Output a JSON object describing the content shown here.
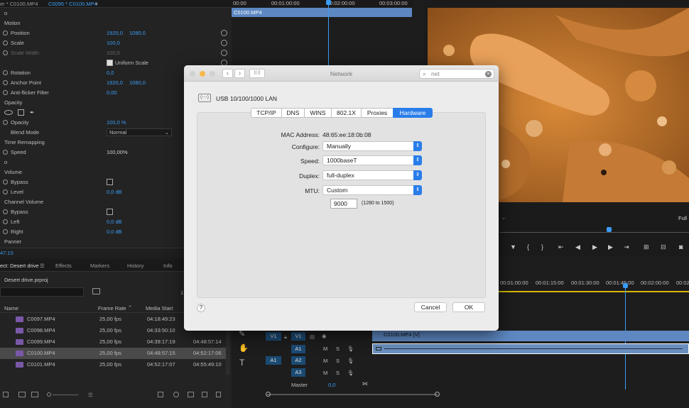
{
  "effect_controls": {
    "tab_left": "er * C0100.MP4",
    "tab_active": "C0095 * C0100.MP4",
    "clip_name": "C0100.MP4",
    "rows": [
      {
        "label": "o",
        "kind": "section"
      },
      {
        "label": "Motion",
        "kind": "section"
      },
      {
        "label": "Position",
        "v1": "1920,0",
        "v2": "1080,0",
        "kind": "prop"
      },
      {
        "label": "Scale",
        "v1": "100,0",
        "kind": "prop"
      },
      {
        "label": "Scale Width",
        "v1": "100,0",
        "kind": "disabled"
      },
      {
        "label": "Uniform Scale",
        "kind": "check"
      },
      {
        "label": "Rotation",
        "v1": "0,0",
        "kind": "prop"
      },
      {
        "label": "Anchor Point",
        "v1": "1920,0",
        "v2": "1080,0",
        "kind": "prop"
      },
      {
        "label": "Anti-flicker Filter",
        "v1": "0,00",
        "kind": "prop"
      },
      {
        "label": "Opacity",
        "kind": "section"
      },
      {
        "label": "",
        "kind": "shapes"
      },
      {
        "label": "Opacity",
        "v1": "100,0 %",
        "kind": "prop"
      },
      {
        "label": "Blend Mode",
        "v1": "Normal",
        "kind": "dropdown"
      },
      {
        "label": "Time Remapping",
        "kind": "section"
      },
      {
        "label": "Speed",
        "v1": "100,00%",
        "kind": "propw"
      },
      {
        "label": "o",
        "kind": "section"
      },
      {
        "label": "Volume",
        "kind": "section"
      },
      {
        "label": "Bypass",
        "kind": "checkv"
      },
      {
        "label": "Level",
        "v1": "0,0 dB",
        "kind": "prop"
      },
      {
        "label": "Channel Volume",
        "kind": "section"
      },
      {
        "label": "Bypass",
        "kind": "checkv"
      },
      {
        "label": "Left",
        "v1": "0,0 dB",
        "kind": "prop"
      },
      {
        "label": "Right",
        "v1": "0,0 dB",
        "kind": "prop"
      },
      {
        "label": "Panner",
        "kind": "section"
      }
    ],
    "timecode": "47:15"
  },
  "project": {
    "tabs": [
      "ect: Desert drive",
      "Effects",
      "Markers",
      "History",
      "Info"
    ],
    "file": "Desert drive.prproj",
    "count": "1",
    "columns": [
      "Name",
      "Frame Rate",
      "Media Start"
    ],
    "rows": [
      {
        "name": "C0097.MP4",
        "rate": "25,00 fps",
        "start": "04:18:49:23",
        "end": ""
      },
      {
        "name": "C0098.MP4",
        "rate": "25,00 fps",
        "start": "04:33:50:10",
        "end": ""
      },
      {
        "name": "C0099.MP4",
        "rate": "25,00 fps",
        "start": "04:39:17:19",
        "end": "04:48:57:14"
      },
      {
        "name": "C0100.MP4",
        "rate": "25,00 fps",
        "start": "04:48:57:15",
        "end": "04:52:17:06",
        "selected": true
      },
      {
        "name": "C0101.MP4",
        "rate": "25,00 fps",
        "start": "04:52:17:07",
        "end": "04:55:49:10"
      }
    ]
  },
  "source_timeline": {
    "ruler": [
      "00:00",
      "00:01:00:00",
      "00:02:00:00",
      "00:03:00:00"
    ],
    "clip": "C0100.MP4"
  },
  "program": {
    "zoom": "Full"
  },
  "sequence": {
    "ruler": [
      "00:01:00:00",
      "00:01:15:00",
      "00:01:30:00",
      "00:01:45:00",
      "00:02:00:00",
      "00:02:15:00"
    ],
    "video_clip": "C0100.MP4 [V]",
    "tracks": [
      "V1",
      "A1",
      "A2",
      "A3"
    ],
    "src_v": "V1",
    "src_a": "A1",
    "master_label": "Master",
    "master_value": "0,0"
  },
  "dialog": {
    "title": "Network",
    "search_value": "net",
    "interface": "USB 10/100/1000 LAN",
    "tabs": [
      "TCP/IP",
      "DNS",
      "WINS",
      "802.1X",
      "Proxies",
      "Hardware"
    ],
    "active_tab": "Hardware",
    "mac_label": "MAC Address:",
    "mac_value": "48:65:ee:18:0b:08",
    "configure_label": "Configure:",
    "configure_value": "Manually",
    "speed_label": "Speed:",
    "speed_value": "1000baseT",
    "duplex_label": "Duplex:",
    "duplex_value": "full-duplex",
    "mtu_label": "MTU:",
    "mtu_value": "Custom",
    "mtu_number": "9000",
    "mtu_range": "(1280 to 1500)",
    "help": "?",
    "cancel": "Cancel",
    "ok": "OK"
  },
  "colors": {
    "accent": "#2a7de9",
    "premiere_blue": "#3b9cf5",
    "clip_purple": "#7a58a8"
  }
}
